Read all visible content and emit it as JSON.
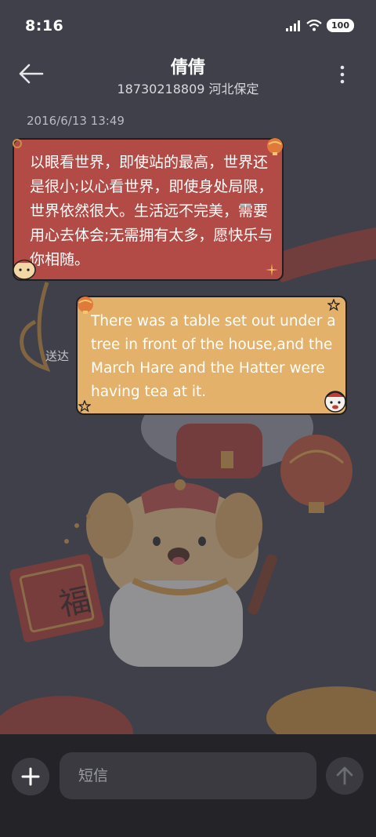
{
  "status_bar": {
    "time": "8:16",
    "battery": "100"
  },
  "header": {
    "contact_name": "倩倩",
    "contact_detail": "18730218809 河北保定"
  },
  "conversation": {
    "timestamp": "2016/6/13 13:49",
    "messages": [
      {
        "direction": "incoming",
        "text": "以眼看世界，即使站的最高，世界还是很小;以心看世界，即使身处局限，世界依然很大。生活远不完美，需要用心去体会;无需拥有太多，愿快乐与你相随。"
      },
      {
        "direction": "outgoing",
        "text": "There was a table set out under a tree in front of the house,and the March Hare and the Hatter were having tea at it."
      }
    ],
    "delivery_status": "送达"
  },
  "composer": {
    "placeholder": "短信"
  },
  "background_art": {
    "badge_char": "福"
  },
  "colors": {
    "background": "#3f4049",
    "incoming_bubble": "#b24b45",
    "outgoing_bubble": "#e3b16a",
    "bottom_bar": "#242428"
  }
}
